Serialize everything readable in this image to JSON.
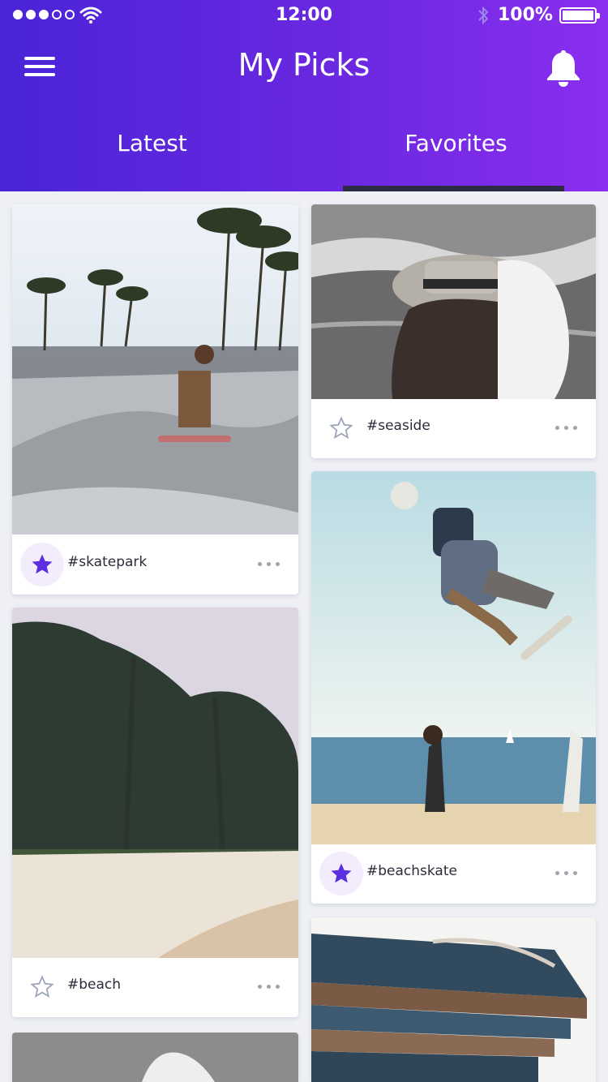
{
  "status": {
    "time": "12:00",
    "battery": "100%"
  },
  "header": {
    "title": "My Picks"
  },
  "tabs": [
    {
      "label": "Latest"
    },
    {
      "label": "Favorites"
    }
  ],
  "cards": [
    {
      "tag": "#skatepark",
      "favorite": true
    },
    {
      "tag": "#seaside",
      "favorite": false
    },
    {
      "tag": "#beachskate",
      "favorite": true
    },
    {
      "tag": "#beach",
      "favorite": false
    }
  ],
  "colors": {
    "accent": "#5b2ee0",
    "header_start": "#4a24d8",
    "header_end": "#8a2ef0"
  },
  "icons": [
    "menu-icon",
    "bell-icon",
    "star-icon",
    "more-icon",
    "wifi-icon",
    "bluetooth-icon",
    "battery-icon"
  ]
}
